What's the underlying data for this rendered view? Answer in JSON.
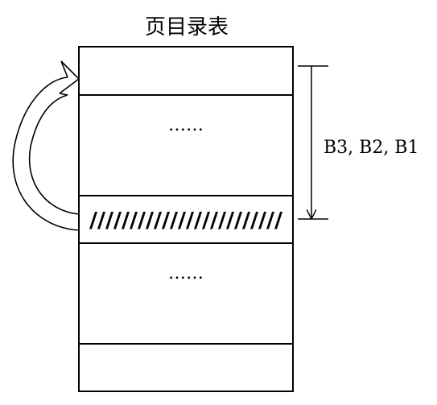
{
  "title": "页目录表",
  "rows": [
    {
      "id": "row-top",
      "text": ""
    },
    {
      "id": "row-dots-upper",
      "text": "……"
    },
    {
      "id": "row-hatched",
      "text": "////////////////////////"
    },
    {
      "id": "row-dots-lower",
      "text": "……"
    },
    {
      "id": "row-bottom",
      "text": ""
    }
  ],
  "side_label": "B3, B2, B1"
}
